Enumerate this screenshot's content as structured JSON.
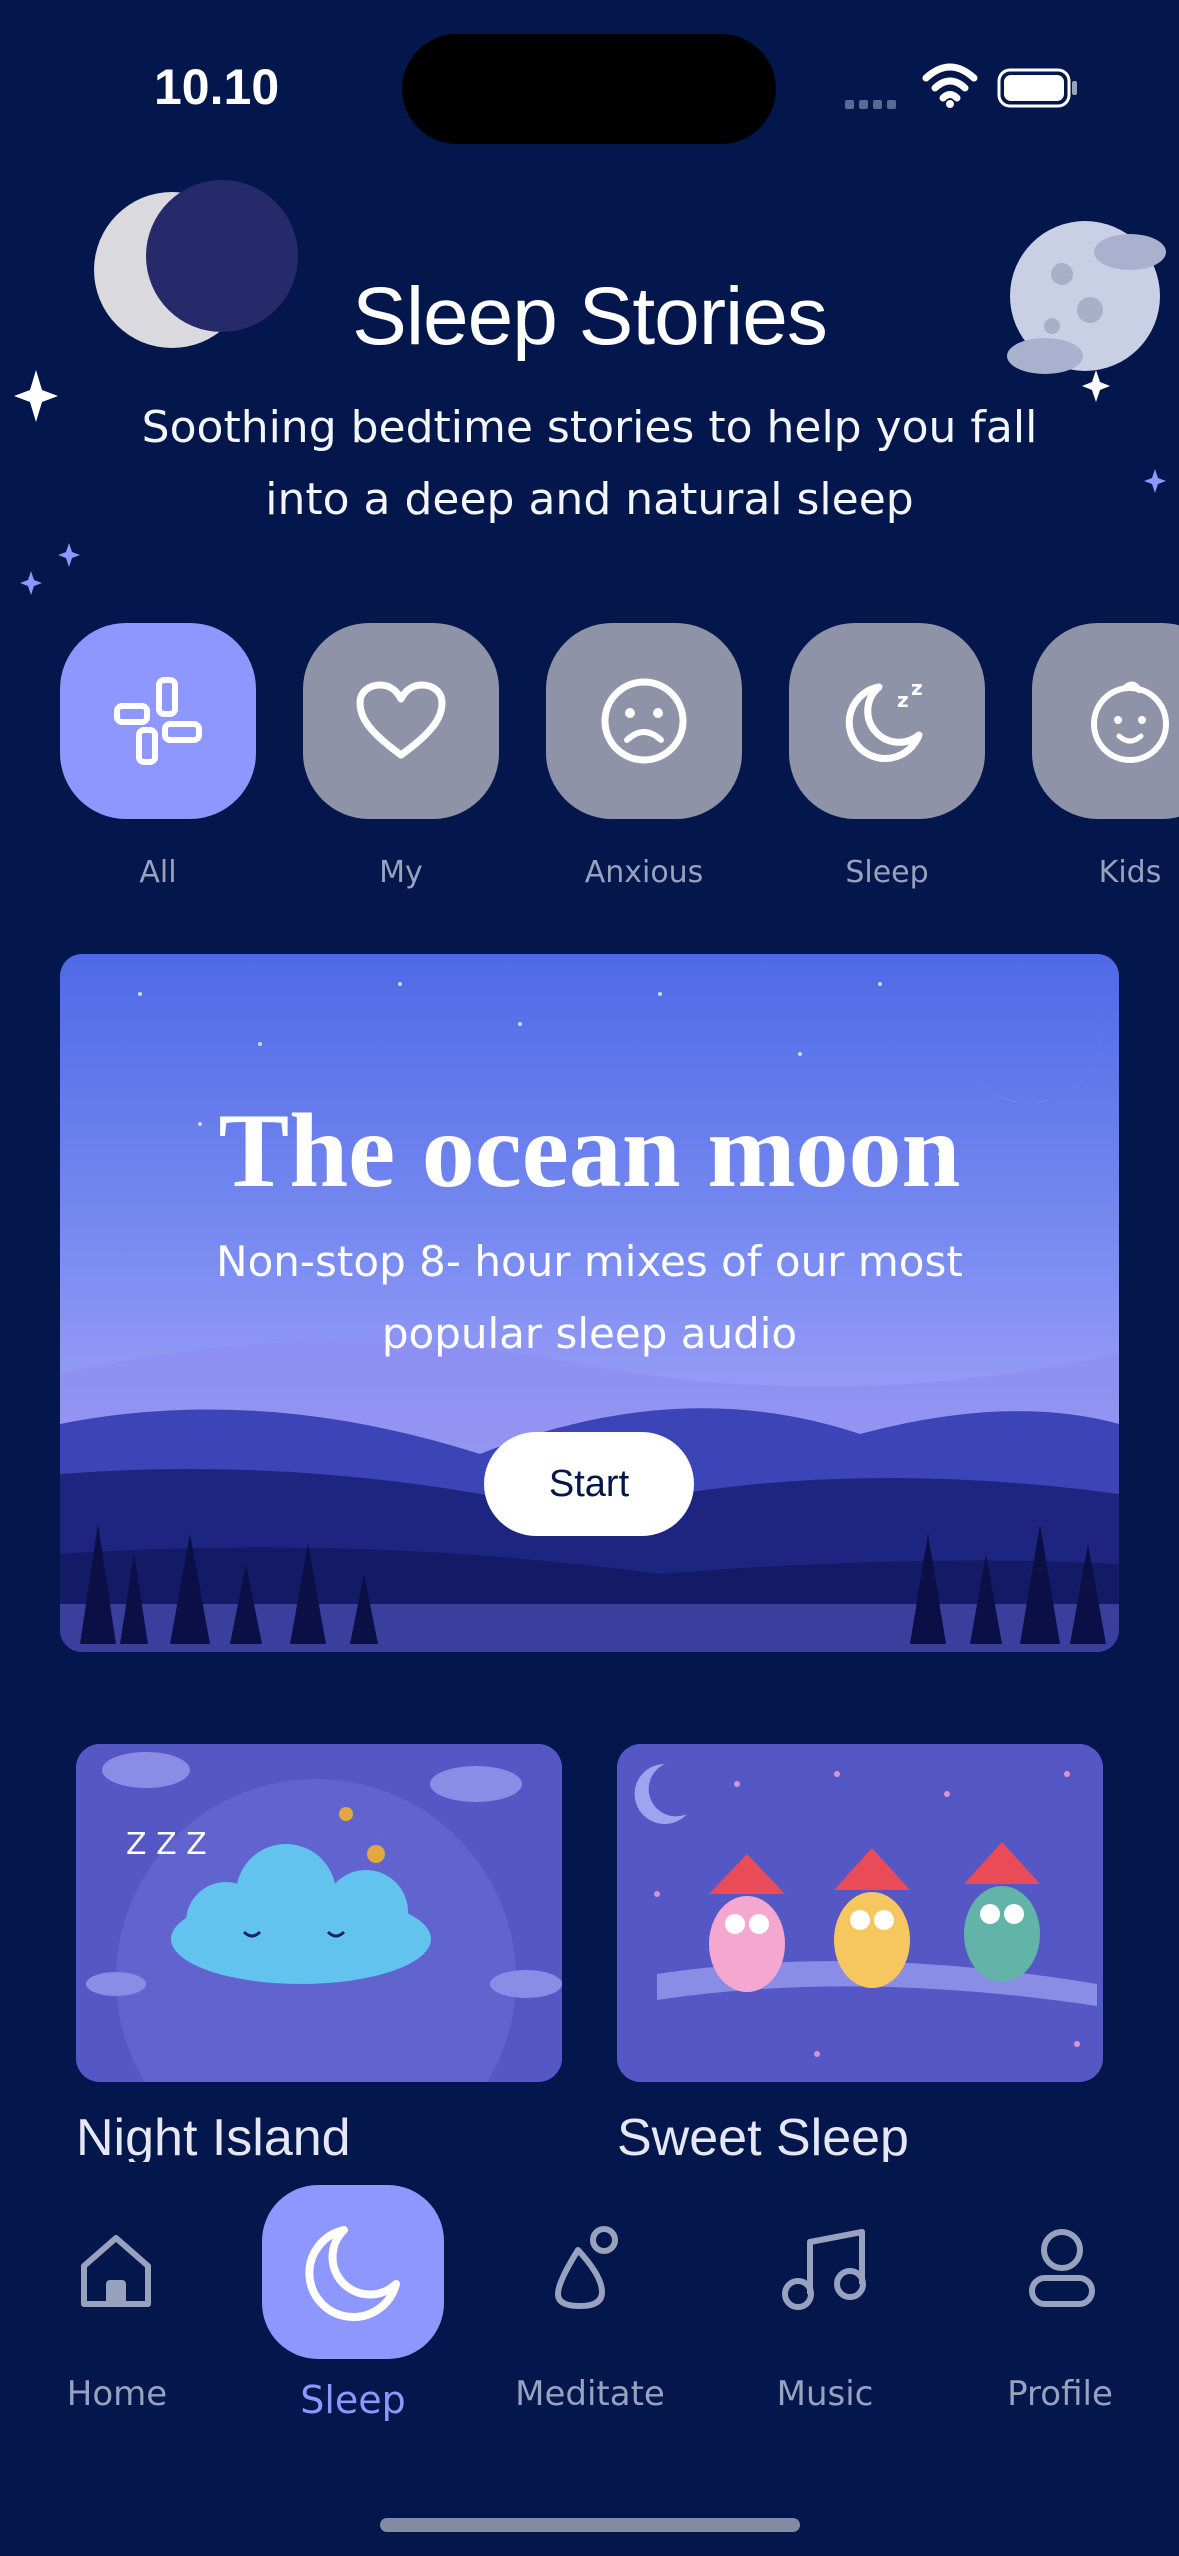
{
  "status_bar": {
    "time": "10.10"
  },
  "header": {
    "title": "Sleep Stories",
    "subtitle": "Soothing bedtime stories to help you fall into a deep and natural sleep"
  },
  "categories": [
    {
      "label": "All",
      "icon": "grid-icon",
      "active": true
    },
    {
      "label": "My",
      "icon": "heart-icon",
      "active": false
    },
    {
      "label": "Anxious",
      "icon": "sad-face-icon",
      "active": false
    },
    {
      "label": "Sleep",
      "icon": "moon-zzz-icon",
      "active": false
    },
    {
      "label": "Kids",
      "icon": "baby-face-icon",
      "active": false
    }
  ],
  "hero": {
    "title": "The ocean moon",
    "description": "Non-stop 8- hour mixes of our most popular sleep audio",
    "button": "Start"
  },
  "cards": [
    {
      "title": "Night Island"
    },
    {
      "title": "Sweet Sleep"
    }
  ],
  "tabs": [
    {
      "label": "Home",
      "icon": "home-icon",
      "active": false
    },
    {
      "label": "Sleep",
      "icon": "moon-icon",
      "active": true
    },
    {
      "label": "Meditate",
      "icon": "meditate-icon",
      "active": false
    },
    {
      "label": "Music",
      "icon": "music-note-icon",
      "active": false
    },
    {
      "label": "Profile",
      "icon": "profile-icon",
      "active": false
    }
  ],
  "colors": {
    "background": "#03174C",
    "accent": "#8E97FD",
    "inactive_category": "#8F93A7",
    "inactive_label": "#98A1BD"
  }
}
